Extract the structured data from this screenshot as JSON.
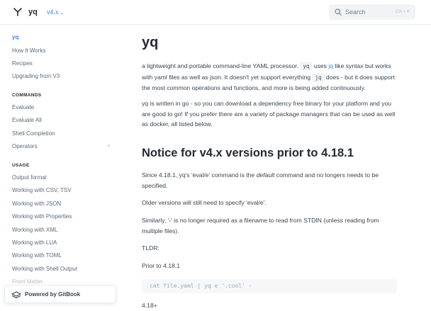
{
  "header": {
    "site_title": "yq",
    "version": "v4.x",
    "search_placeholder": "Search",
    "search_shortcut": "Ctrl + K"
  },
  "sidebar": {
    "top_items": [
      {
        "label": "yq",
        "active": true
      },
      {
        "label": "How It Works"
      },
      {
        "label": "Recipes"
      },
      {
        "label": "Upgrading from V3"
      }
    ],
    "commands_heading": "COMMANDS",
    "commands": [
      {
        "label": "Evaluate"
      },
      {
        "label": "Evaluate All"
      },
      {
        "label": "Shell Completion"
      },
      {
        "label": "Operators",
        "has_children": true
      }
    ],
    "usage_heading": "USAGE",
    "usage": [
      {
        "label": "Output format"
      },
      {
        "label": "Working with CSV, TSV"
      },
      {
        "label": "Working with JSON"
      },
      {
        "label": "Working with Properties"
      },
      {
        "label": "Working with XML"
      },
      {
        "label": "Working with LUA"
      },
      {
        "label": "Working with TOML"
      },
      {
        "label": "Working with Shell Output"
      },
      {
        "label": "Front Matter"
      }
    ],
    "powered_by": "Powered by GitBook"
  },
  "content": {
    "title": "yq",
    "intro": {
      "p1_a": "a lightweight and portable command-line YAML processor. ",
      "p1_code1": "yq",
      "p1_b": " uses ",
      "p1_link": "jq",
      "p1_c": " like syntax but works with yaml files as well as json. It doesn't yet support everything ",
      "p1_code2": "jq",
      "p1_d": " does - but it does support the most common operations and functions, and more is being added continuously."
    },
    "p2": "yq is written in go - so you can download a dependency free binary for your platform and you are good to go! If you prefer there are a variety of package managers that can be used as well as docker, all listed below.",
    "notice_heading": "Notice for v4.x versions prior to 4.18.1",
    "p3_a": "Since 4.18.1, yq's 'eval/e' command is the ",
    "p3_em": "default",
    "p3_b": " command and no longers needs to be specified.",
    "p4": "Older versions will still need to specify 'eval/e'.",
    "p5": "Similarly, '-' is no longer required as a filename to read from STDIN (unless reading from multiple files).",
    "tldr": "TLDR:",
    "prior": "Prior to 4.18.1",
    "code_example": "cat file.yaml | yq e '.cool' -",
    "after": "4.18+"
  }
}
